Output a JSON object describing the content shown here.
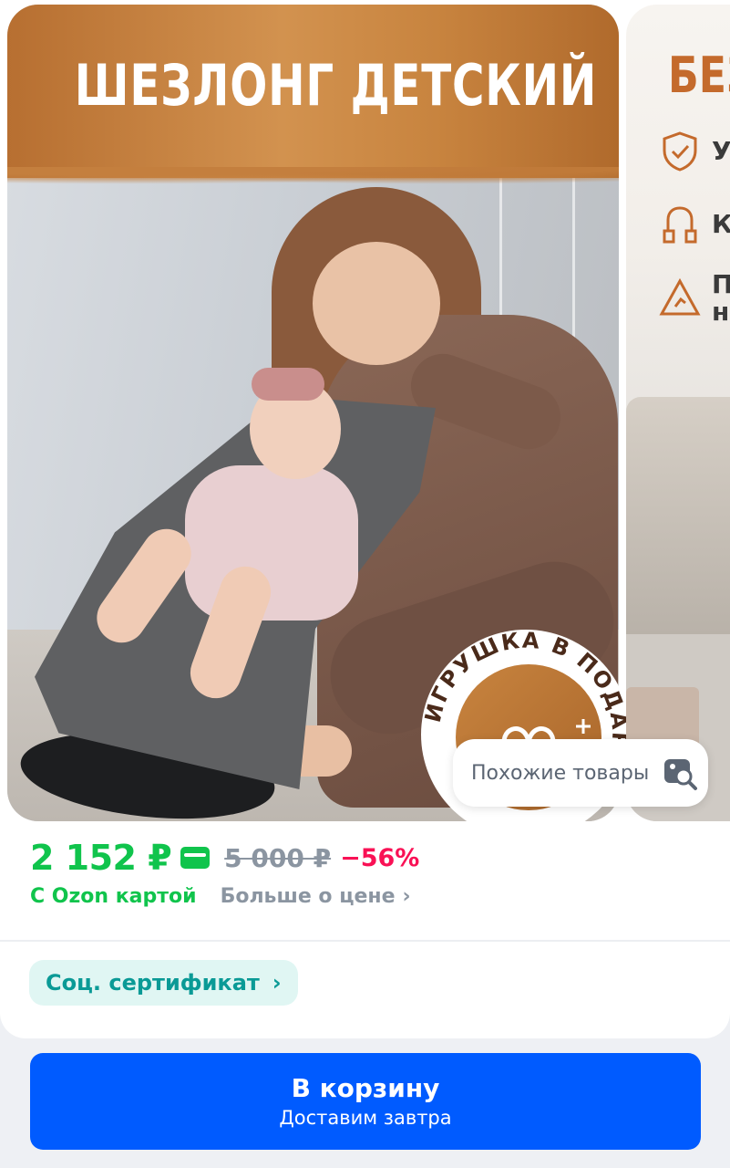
{
  "product_image": {
    "banner_title": "ШЕЗЛОНГ ДЕТСКИЙ",
    "badge_text": "ИГРУШКА В ПОДАРОК",
    "next_slide_title": "БЕЗ",
    "next_slide_rows": [
      "У",
      "К",
      "П н"
    ]
  },
  "similar": {
    "label": "Похожие товары",
    "icon": "image-search-icon"
  },
  "price": {
    "current": "2 152 ₽",
    "old": "5 000 ₽",
    "discount": "−56%",
    "ozon_card_label": "С Ozon картой",
    "more_label": "Больше о цене",
    "colors": {
      "current": "#10c44c",
      "discount": "#f91155",
      "old": "#8b95a1"
    }
  },
  "certificate": {
    "label": "Соц. сертификат"
  },
  "cart_button": {
    "label": "В корзину",
    "sublabel": "Доставим завтра",
    "color": "#005bff"
  }
}
